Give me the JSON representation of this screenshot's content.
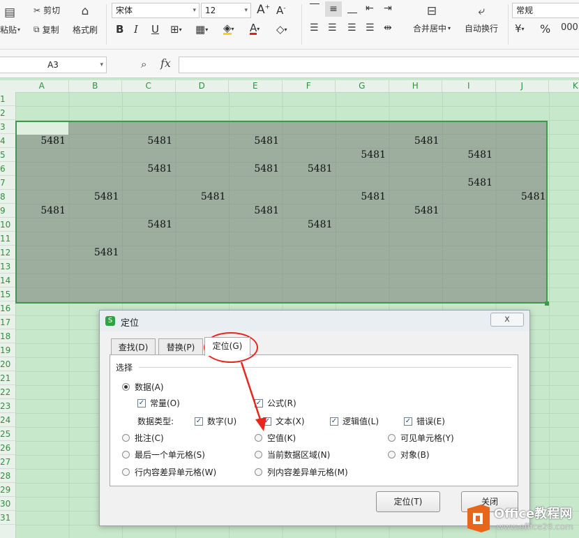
{
  "ribbon": {
    "paste_label": "粘贴",
    "cut_label": "剪切",
    "copy_label": "复制",
    "format_painter_label": "格式刷",
    "font_name": "宋体",
    "font_size": "12",
    "merge_label": "合并居中",
    "wrap_label": "自动换行",
    "number_format": "常规"
  },
  "formula_bar": {
    "name_box": "A3",
    "fx_label": "fx",
    "value": ""
  },
  "grid": {
    "columns": [
      "A",
      "B",
      "C",
      "D",
      "E",
      "F",
      "G",
      "H",
      "I",
      "J",
      "K"
    ],
    "rows": [
      "1",
      "2",
      "3",
      "4",
      "5",
      "6",
      "7",
      "8",
      "9",
      "10",
      "11",
      "12",
      "13",
      "14",
      "15",
      "16",
      "17",
      "18",
      "19",
      "20",
      "21",
      "22",
      "23",
      "24",
      "25",
      "26",
      "27",
      "28",
      "29",
      "30",
      "31"
    ],
    "cells": [
      {
        "row": 4,
        "col": "A",
        "v": "5481"
      },
      {
        "row": 4,
        "col": "C",
        "v": "5481"
      },
      {
        "row": 4,
        "col": "E",
        "v": "5481"
      },
      {
        "row": 4,
        "col": "H",
        "v": "5481"
      },
      {
        "row": 5,
        "col": "G",
        "v": "5481"
      },
      {
        "row": 5,
        "col": "I",
        "v": "5481"
      },
      {
        "row": 6,
        "col": "C",
        "v": "5481"
      },
      {
        "row": 6,
        "col": "E",
        "v": "5481"
      },
      {
        "row": 6,
        "col": "F",
        "v": "5481"
      },
      {
        "row": 7,
        "col": "I",
        "v": "5481"
      },
      {
        "row": 8,
        "col": "B",
        "v": "5481"
      },
      {
        "row": 8,
        "col": "D",
        "v": "5481"
      },
      {
        "row": 8,
        "col": "G",
        "v": "5481"
      },
      {
        "row": 8,
        "col": "J",
        "v": "5481"
      },
      {
        "row": 9,
        "col": "A",
        "v": "5481"
      },
      {
        "row": 9,
        "col": "E",
        "v": "5481"
      },
      {
        "row": 9,
        "col": "H",
        "v": "5481"
      },
      {
        "row": 10,
        "col": "C",
        "v": "5481"
      },
      {
        "row": 10,
        "col": "F",
        "v": "5481"
      },
      {
        "row": 12,
        "col": "B",
        "v": "5481"
      }
    ]
  },
  "dialog": {
    "title": "定位",
    "close_glyph": "x",
    "tabs": [
      "查找(D)",
      "替换(P)",
      "定位(G)"
    ],
    "group_label": "选择",
    "options": {
      "data": "数据(A)",
      "constants": "常量(O)",
      "formulas": "公式(R)",
      "data_type_label": "数据类型:",
      "numbers": "数字(U)",
      "text": "文本(X)",
      "logical": "逻辑值(L)",
      "errors": "错误(E)",
      "comments": "批注(C)",
      "blanks": "空值(K)",
      "visible_cells": "可见单元格(Y)",
      "last_cell": "最后一个单元格(S)",
      "current_region": "当前数据区域(N)",
      "objects": "对象(B)",
      "row_diff": "行内容差异单元格(W)",
      "col_diff": "列内容差异单元格(M)"
    },
    "locate_button": "定位(T)",
    "close_button": "关闭"
  },
  "watermark": {
    "brand": "Office教程网",
    "url": "www.office26.com"
  },
  "colors": {
    "accent_green": "#3c9a4a",
    "annotation_red": "#e8251e",
    "watermark_orange": "#e8661c"
  }
}
